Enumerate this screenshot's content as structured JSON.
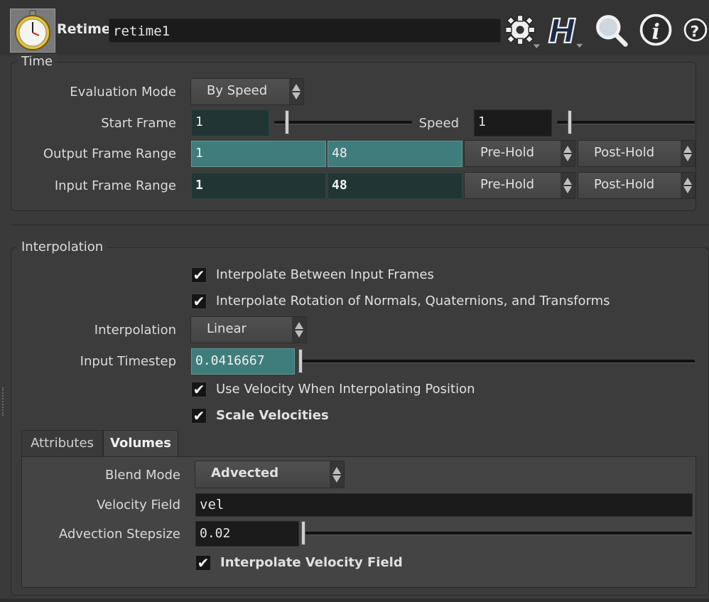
{
  "header": {
    "node_type": "Retime",
    "node_name": "retime1",
    "icons": [
      "stopwatch-icon",
      "gear-icon",
      "houdini-h-icon",
      "search-icon",
      "info-icon",
      "help-icon"
    ]
  },
  "time": {
    "legend": "Time",
    "evaluation_mode": {
      "label": "Evaluation Mode",
      "value": "By Speed"
    },
    "start_frame": {
      "label": "Start Frame",
      "value": "1"
    },
    "speed": {
      "label": "Speed",
      "value": "1"
    },
    "output_range": {
      "label": "Output Frame Range",
      "start": "1",
      "end": "48",
      "pre": "Pre-Hold",
      "post": "Post-Hold"
    },
    "input_range": {
      "label": "Input Frame Range",
      "start": "1",
      "end": "48",
      "pre": "Pre-Hold",
      "post": "Post-Hold"
    }
  },
  "interpolation": {
    "legend": "Interpolation",
    "cb_between": "Interpolate Between Input Frames",
    "cb_rotation": "Interpolate Rotation of Normals, Quaternions, and Transforms",
    "mode": {
      "label": "Interpolation",
      "value": "Linear"
    },
    "timestep": {
      "label": "Input Timestep",
      "value": "0.0416667"
    },
    "cb_velocity": "Use Velocity When Interpolating Position",
    "cb_scale": "Scale Velocities"
  },
  "tabs": [
    "Attributes",
    "Volumes"
  ],
  "volumes": {
    "blend_mode": {
      "label": "Blend Mode",
      "value": "Advected"
    },
    "velocity_field": {
      "label": "Velocity Field",
      "value": "vel"
    },
    "advection_stepsize": {
      "label": "Advection Stepsize",
      "value": "0.02"
    },
    "cb_interp_vel": "Interpolate Velocity Field"
  },
  "check_mark": "✔"
}
